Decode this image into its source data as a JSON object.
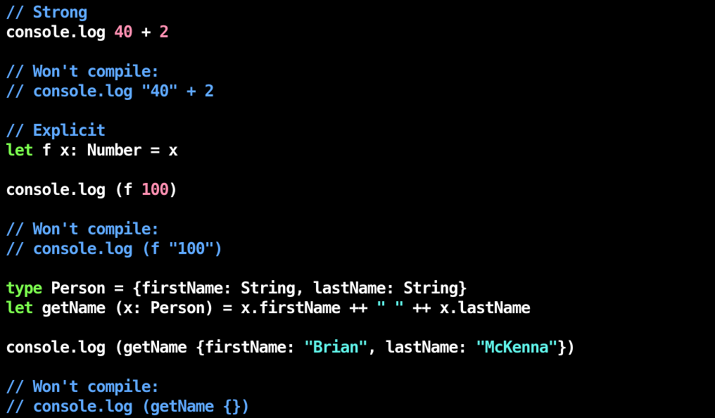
{
  "colors": {
    "background": "#000000",
    "plain": "#ffffff",
    "comment": "#5ea8ff",
    "keyword": "#7cff4f",
    "number": "#ff8fb1",
    "string": "#5ff0e6"
  },
  "lines": [
    [
      {
        "t": "comment",
        "v": "// Strong"
      }
    ],
    [
      {
        "t": "plain",
        "v": "console.log "
      },
      {
        "t": "number",
        "v": "40"
      },
      {
        "t": "plain",
        "v": " + "
      },
      {
        "t": "number",
        "v": "2"
      }
    ],
    [],
    [
      {
        "t": "comment",
        "v": "// Won't compile:"
      }
    ],
    [
      {
        "t": "comment",
        "v": "// console.log \"40\" + 2"
      }
    ],
    [],
    [
      {
        "t": "comment",
        "v": "// Explicit"
      }
    ],
    [
      {
        "t": "keyword",
        "v": "let"
      },
      {
        "t": "plain",
        "v": " f x: Number = x"
      }
    ],
    [],
    [
      {
        "t": "plain",
        "v": "console.log (f "
      },
      {
        "t": "number",
        "v": "100"
      },
      {
        "t": "plain",
        "v": ")"
      }
    ],
    [],
    [
      {
        "t": "comment",
        "v": "// Won't compile:"
      }
    ],
    [
      {
        "t": "comment",
        "v": "// console.log (f \"100\")"
      }
    ],
    [],
    [
      {
        "t": "keyword",
        "v": "type"
      },
      {
        "t": "plain",
        "v": " Person = {firstName: String, lastName: String}"
      }
    ],
    [
      {
        "t": "keyword",
        "v": "let"
      },
      {
        "t": "plain",
        "v": " getName (x: Person) = x.firstName ++ "
      },
      {
        "t": "string",
        "v": "\" \""
      },
      {
        "t": "plain",
        "v": " ++ x.lastName"
      }
    ],
    [],
    [
      {
        "t": "plain",
        "v": "console.log (getName {firstName: "
      },
      {
        "t": "string",
        "v": "\"Brian\""
      },
      {
        "t": "plain",
        "v": ", lastName: "
      },
      {
        "t": "string",
        "v": "\"McKenna\""
      },
      {
        "t": "plain",
        "v": "})"
      }
    ],
    [],
    [
      {
        "t": "comment",
        "v": "// Won't compile:"
      }
    ],
    [
      {
        "t": "comment",
        "v": "// console.log (getName {})"
      }
    ]
  ]
}
